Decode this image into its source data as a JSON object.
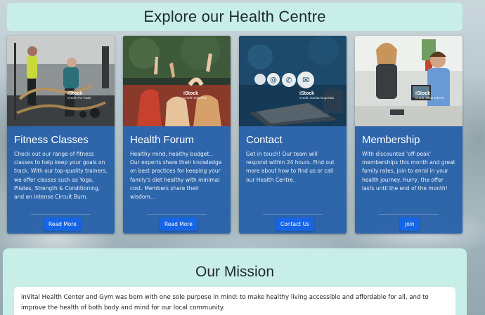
{
  "header": {
    "title": "Explore our Health Centre"
  },
  "cards": [
    {
      "title": "Fitness Classes",
      "body": "Check out our range of fitness classes to help keep your goals on track. With our top-quality trainers, we offer classes such as Yoga, Pilates, Strength & Conditioning, and an intense Circuit Burn.",
      "button": "Read More",
      "credit_brand": "iStock",
      "credit_by": "Credit: FG Trade"
    },
    {
      "title": "Health Forum",
      "body": "Healthy mind, healthy budget.. Our experts share their knowledge on best practices for keeping your family's diet healthy with minimal cost. Members share their wisdom...",
      "button": "Read More",
      "credit_brand": "iStock",
      "credit_by": "Credit: Imbenies"
    },
    {
      "title": "Contact",
      "body": "Get in touch! Our team will respond within 24 hours. Find out more about how to find us or call our Health Centre.",
      "button": "Contact Us",
      "credit_brand": "iStock",
      "credit_by": "Credit: Suchat longchaia"
    },
    {
      "title": "Membership",
      "body": "With discounted 'off-peak' memberships this month and great family rates, join to enrol in your health journey. Hurry, the offer lasts until the end of the month!",
      "button": "Join",
      "credit_brand": "iStock",
      "credit_by": "Credit: Milan Zrkovic"
    }
  ],
  "mission": {
    "title": "Our Mission",
    "text": "inVital Health Center and Gym was born with one sole purpose in mind: to make healthy living accessible and affordable for all, and to improve the health of both body and mind for our local community."
  },
  "colors": {
    "card_bg": "#245ea8",
    "button": "#1565e4",
    "banner": "#c8eee8"
  }
}
